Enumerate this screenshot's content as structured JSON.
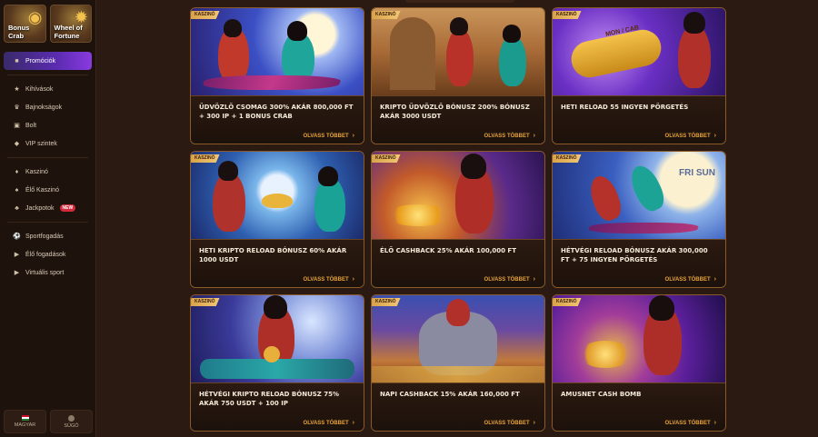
{
  "sidebar": {
    "tiles": [
      {
        "label": "Bonus Crab",
        "icon": "crab-icon"
      },
      {
        "label": "Wheel of Fortune",
        "icon": "wheel-icon"
      }
    ],
    "nav": [
      {
        "label": "Promóciók",
        "icon": "gift-icon",
        "active": true
      },
      {
        "label": "Kihívások",
        "icon": "trophy-icon"
      },
      {
        "label": "Bajnokságok",
        "icon": "tournament-icon"
      },
      {
        "label": "Bolt",
        "icon": "shop-icon"
      },
      {
        "label": "VIP szintek",
        "icon": "diamond-icon"
      },
      {
        "label": "Kaszinó",
        "icon": "casino-icon"
      },
      {
        "label": "Élő Kaszinó",
        "icon": "live-casino-icon"
      },
      {
        "label": "Jackpotok",
        "icon": "clover-icon",
        "badge": "NEW"
      },
      {
        "label": "Sportfogadás",
        "icon": "sports-icon"
      },
      {
        "label": "Élő fogadások",
        "icon": "live-bets-icon"
      },
      {
        "label": "Virtuális sport",
        "icon": "virtual-sport-icon"
      }
    ],
    "bottom": {
      "language": "MAGYAR",
      "help": "SÚGÓ"
    }
  },
  "promotions": [
    {
      "tag": "KASZINÓ",
      "title": "Üdvözlő csomag 300% akár 800,000 Ft + 300 IP + 1 Bonus Crab",
      "more": "OLVASS TÖBBET"
    },
    {
      "tag": "KASZINÓ",
      "title": "Kripto üdvözlő bónusz 200% bónusz akár 3000 USDT",
      "more": "OLVASS TÖBBET"
    },
    {
      "tag": "KASZINÓ",
      "title": "Heti reload 55 ingyen pörgetés",
      "more": "OLVASS TÖBBET"
    },
    {
      "tag": "KASZINÓ",
      "title": "Heti kripto reload bónusz 60% akár 1000 USDT",
      "more": "OLVASS TÖBBET"
    },
    {
      "tag": "KASZINÓ",
      "title": "Élő cashback 25% akár 100,000 Ft",
      "more": "OLVASS TÖBBET"
    },
    {
      "tag": "KASZINÓ",
      "title": "Hétvégi reload bónusz akár 300,000 Ft + 75 ingyen pörgetés",
      "more": "OLVASS TÖBBET"
    },
    {
      "tag": "KASZINÓ",
      "title": "Hétvégi kripto reload bónusz 75% akár 750 USDT + 100 IP",
      "more": "OLVASS TÖBBET"
    },
    {
      "tag": "KASZINÓ",
      "title": "Napi cashback 15% akár 160,000 Ft",
      "more": "OLVASS TÖBBET"
    },
    {
      "tag": "KASZINÓ",
      "title": "Amusnet Cash Bomb",
      "more": "OLVASS TÖBBET"
    }
  ],
  "art_text": {
    "reel": "MON / CAB",
    "weekend": "FRI SUN"
  },
  "colors": {
    "accent": "#e8a33a",
    "active_nav": "#5a2bb0",
    "card_border": "#8a5a2a",
    "tag": "#f2c774"
  }
}
